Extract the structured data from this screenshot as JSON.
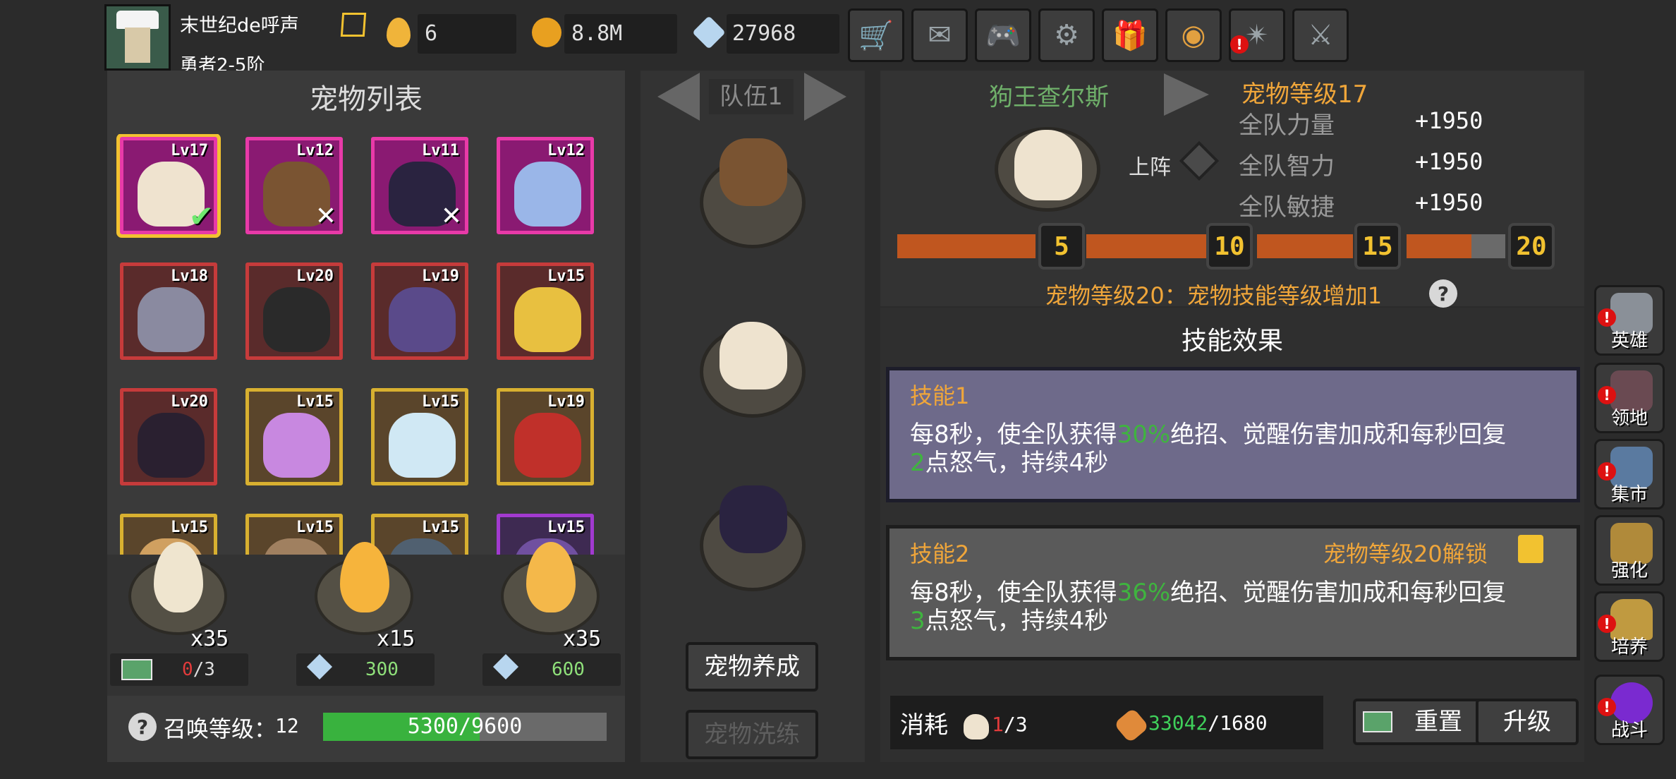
{
  "player": {
    "name": "末世纪de呼声",
    "rank": "勇者2-5阶"
  },
  "resources": [
    {
      "icon": "egg-icon",
      "value": "6"
    },
    {
      "icon": "gold-coin-icon",
      "value": "8.8M"
    },
    {
      "icon": "diamond-plus-icon",
      "value": "27968"
    }
  ],
  "top_buttons": [
    {
      "name": "shop-cart-button",
      "icon": "🛒"
    },
    {
      "name": "mail-button",
      "icon": "✉"
    },
    {
      "name": "gamepad-button",
      "icon": "🎮"
    },
    {
      "name": "settings-gear-button",
      "icon": "⚙"
    },
    {
      "name": "gift-button",
      "icon": "🎁"
    },
    {
      "name": "color-wheel-button",
      "icon": "◉"
    },
    {
      "name": "fireworks-button",
      "icon": "✴"
    },
    {
      "name": "crossed-swords-button",
      "icon": "⚔"
    }
  ],
  "pet_list": {
    "title": "宠物列表",
    "pets": [
      {
        "level": "Lv17",
        "rarity": "epic",
        "mark": "check",
        "selected": true
      },
      {
        "level": "Lv12",
        "rarity": "epic",
        "mark": "cross"
      },
      {
        "level": "Lv11",
        "rarity": "epic",
        "mark": "cross"
      },
      {
        "level": "Lv12",
        "rarity": "epic",
        "mark": ""
      },
      {
        "level": "Lv18",
        "rarity": "rare",
        "mark": ""
      },
      {
        "level": "Lv20",
        "rarity": "rare",
        "mark": ""
      },
      {
        "level": "Lv19",
        "rarity": "rare",
        "mark": ""
      },
      {
        "level": "Lv15",
        "rarity": "rare",
        "mark": ""
      },
      {
        "level": "Lv20",
        "rarity": "rare",
        "mark": ""
      },
      {
        "level": "Lv15",
        "rarity": "legendary",
        "mark": ""
      },
      {
        "level": "Lv15",
        "rarity": "legendary",
        "mark": ""
      },
      {
        "level": "Lv19",
        "rarity": "legendary",
        "mark": ""
      },
      {
        "level": "Lv15",
        "rarity": "legendary",
        "mark": ""
      },
      {
        "level": "Lv15",
        "rarity": "legendary",
        "mark": ""
      },
      {
        "level": "Lv15",
        "rarity": "legendary",
        "mark": ""
      },
      {
        "level": "Lv15",
        "rarity": "purple",
        "mark": ""
      }
    ]
  },
  "eggs": [
    {
      "count": "x35",
      "cost_value": "0",
      "cost_total": "/3",
      "cost_icon": "video-ad-icon",
      "cost_color": "#e23b3b"
    },
    {
      "count": "x15",
      "cost_value": "300",
      "cost_total": "",
      "cost_icon": "diamond-icon",
      "cost_color": "#8fe07a"
    },
    {
      "count": "x35",
      "cost_value": "600",
      "cost_total": "",
      "cost_icon": "diamond-icon",
      "cost_color": "#8fe07a"
    }
  ],
  "summon": {
    "label": "召唤等级：",
    "level": "12",
    "progress_text": "5300/9600",
    "progress": 0.552
  },
  "team": {
    "label": "队伍1",
    "train_button": "宠物养成",
    "wash_button": "宠物洗练"
  },
  "detail": {
    "pet_name": "狗王查尔斯",
    "pet_level": "宠物等级17",
    "deploy_label": "上阵",
    "stats": [
      {
        "label": "全队力量",
        "value": "+1950"
      },
      {
        "label": "全队智力",
        "value": "+1950"
      },
      {
        "label": "全队敏捷",
        "value": "+1950"
      }
    ],
    "milestones": [
      "5",
      "10",
      "15",
      "20"
    ],
    "milestone_note": "宠物等级20：宠物技能等级增加1"
  },
  "skills": {
    "title": "技能效果",
    "list": [
      {
        "name": "技能1",
        "desc_a": "每8秒，使全队获得",
        "pct": "30%",
        "desc_b": "绝招、觉醒伤害加成和每秒回复",
        "rage": "2",
        "desc_c": "点怒气，持续4秒",
        "unlock": ""
      },
      {
        "name": "技能2",
        "desc_a": "每8秒，使全队获得",
        "pct": "36%",
        "desc_b": "绝招、觉醒伤害加成和每秒回复",
        "rage": "3",
        "desc_c": "点怒气，持续4秒",
        "unlock": "宠物等级20解锁"
      }
    ]
  },
  "cost": {
    "label": "消耗",
    "pet_have": "1",
    "pet_need": "/3",
    "bone_have": "33042",
    "bone_need": "/1680",
    "reset_button": "重置",
    "upgrade_button": "升级"
  },
  "side_nav": [
    {
      "label": "英雄",
      "alert": "!"
    },
    {
      "label": "领地",
      "alert": "!"
    },
    {
      "label": "集市",
      "alert": "!"
    },
    {
      "label": "强化",
      "alert": ""
    },
    {
      "label": "培养",
      "alert": "!"
    },
    {
      "label": "战斗",
      "alert": "!"
    }
  ]
}
